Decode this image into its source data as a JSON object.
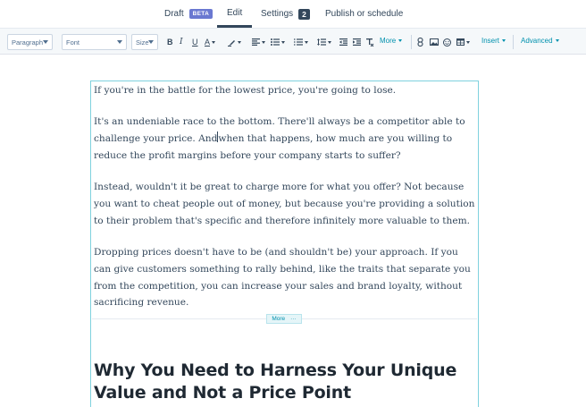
{
  "tabs": [
    {
      "label": "Draft",
      "badge": "BETA"
    },
    {
      "label": "Edit"
    },
    {
      "label": "Settings",
      "count": "2"
    },
    {
      "label": "Publish or schedule"
    }
  ],
  "toolbar": {
    "paragraph": "Paragraph",
    "font": "Font",
    "size": "Size",
    "bold": "B",
    "italic": "I",
    "underline": "U",
    "text_color": "A",
    "more": "More",
    "insert": "Insert",
    "advanced": "Advanced"
  },
  "editor": {
    "p1": "If you're in the battle for the lowest price, you're going to lose.",
    "p2a": "It's an undeniable race to the bottom. There'll always be a competitor able to challenge your price. And",
    "p2b": "when that happens, how much are you willing to reduce the profit margins before your company starts to suffer?",
    "p3": "Instead, wouldn't it be great to charge more for what you offer? Not because you want to cheat people out of money, but because you're providing a solution to their problem that's specific and therefore infinitely more valuable to them.",
    "p4": "Dropping prices doesn't have to be (and shouldn't be) your approach. If you can give customers something to rally behind, like the traits that separate you from the competition, you can increase your sales and brand loyalty, without sacrificing revenue.",
    "more_label": "More",
    "more_dots": "···",
    "heading": "Why You Need to Harness Your Unique Value and Not a Price Point"
  }
}
